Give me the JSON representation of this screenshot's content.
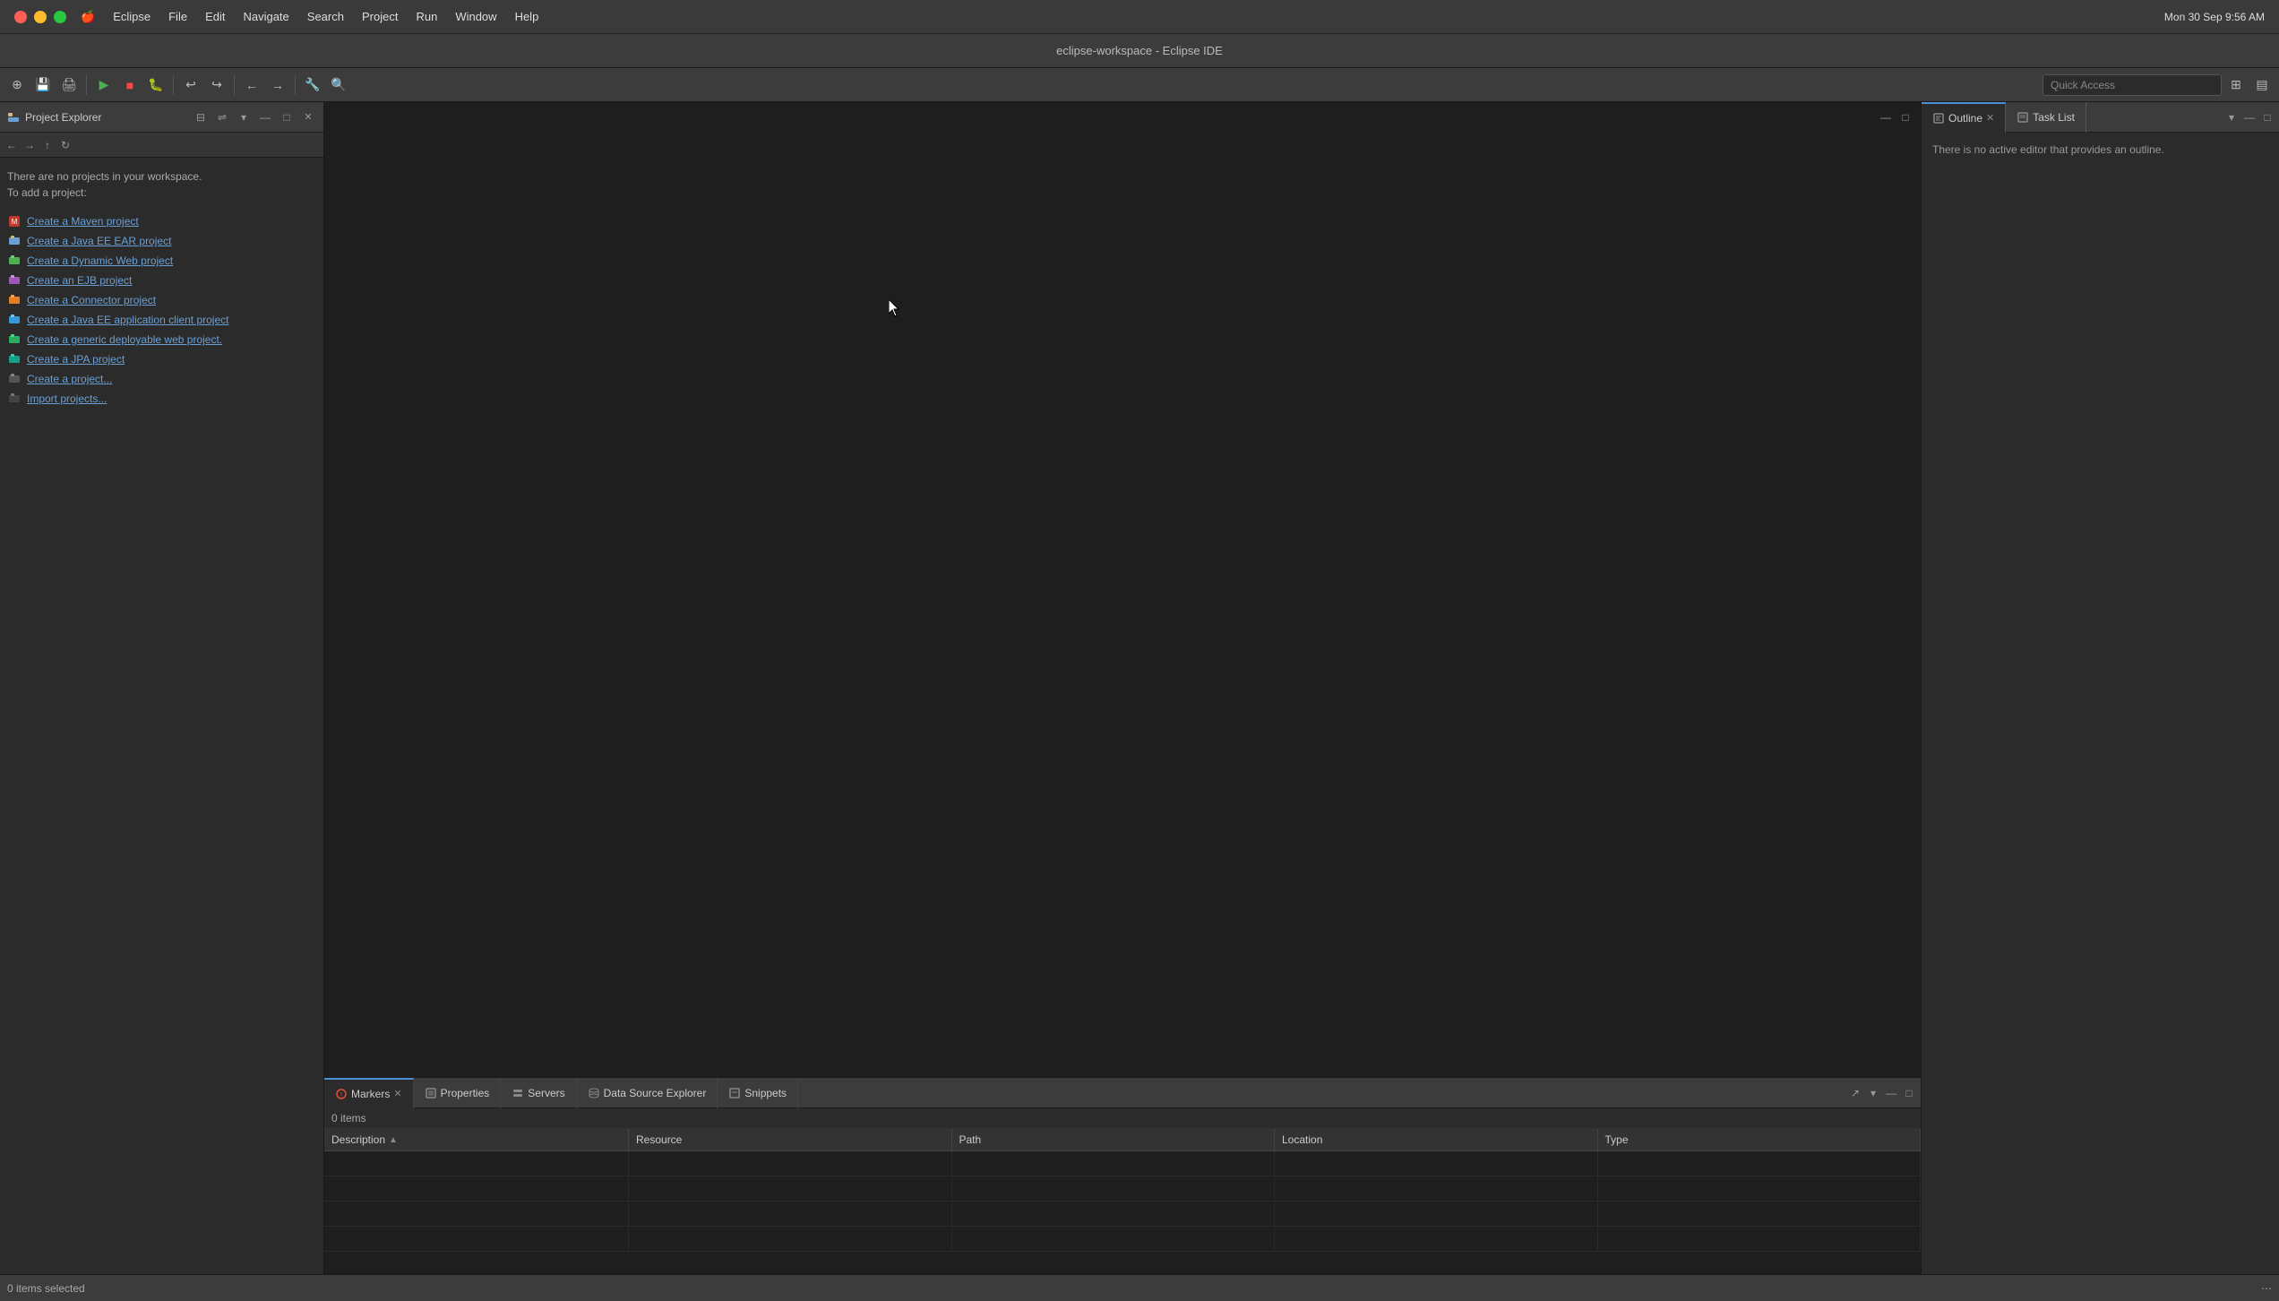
{
  "macbar": {
    "apple": "🍎",
    "items": [
      "Eclipse",
      "File",
      "Edit",
      "Navigate",
      "Search",
      "Project",
      "Run",
      "Window",
      "Help"
    ],
    "right": "Mon 30 Sep  9:56 AM"
  },
  "titlebar": {
    "title": "eclipse-workspace - Eclipse IDE"
  },
  "toolbar": {
    "quick_access_placeholder": "Quick Access"
  },
  "left_panel": {
    "title": "Project Explorer",
    "no_projects_line1": "There are no projects in your workspace.",
    "no_projects_line2": "To add a project:",
    "links": [
      {
        "label": "Create a Maven project"
      },
      {
        "label": "Create a Java EE EAR project"
      },
      {
        "label": "Create a Dynamic Web project"
      },
      {
        "label": "Create an EJB project"
      },
      {
        "label": "Create a Connector project"
      },
      {
        "label": "Create a Java EE application client project"
      },
      {
        "label": "Create a generic deployable web project."
      },
      {
        "label": "Create a JPA project"
      },
      {
        "label": "Create a project..."
      },
      {
        "label": "Import projects..."
      }
    ]
  },
  "outline_panel": {
    "tabs": [
      "Outline",
      "Task List"
    ],
    "active_tab": "Outline",
    "content": "There is no active editor that provides an outline."
  },
  "bottom_panel": {
    "tabs": [
      "Markers",
      "Properties",
      "Servers",
      "Data Source Explorer",
      "Snippets"
    ],
    "active_tab": "Markers",
    "items_count": "0 items",
    "table_headers": [
      "Description",
      "Resource",
      "Path",
      "Location",
      "Type"
    ]
  },
  "status_bar": {
    "left": "0 items selected",
    "right": ""
  }
}
